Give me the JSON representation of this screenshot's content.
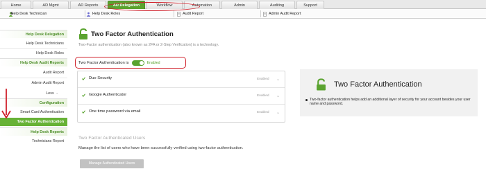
{
  "top_tabs": [
    {
      "label": "Home"
    },
    {
      "label": "AD Mgmt"
    },
    {
      "label": "AD Reports"
    },
    {
      "label": "AD Delegation",
      "active": true
    },
    {
      "label": "Workflow"
    },
    {
      "label": "Automation"
    },
    {
      "label": "Admin"
    },
    {
      "label": "Auditing"
    },
    {
      "label": "Support"
    }
  ],
  "sub_nav": {
    "help_desk_technician": "Help Desk Technician",
    "help_desk_technician_prefix": "S",
    "help_desk_roles": "Help Desk Roles",
    "audit_report": "Audit Report",
    "admin_audit_report": "Admin Audit Report"
  },
  "sidebar": {
    "section_delegation": "Help Desk Delegation",
    "help_desk_technicians": "Help Desk Technicians",
    "help_desk_roles": "Help Desk Roles",
    "section_audit": "Help Desk Audit Reports",
    "audit_report": "Audit Report",
    "admin_audit_report": "Admin Audit Report",
    "less": "Less",
    "less_marker": "-",
    "section_configuration": "Configuration",
    "smart_card_authentication": "Smart Card Authentication",
    "two_factor_authentication": "Two Factor Authentication",
    "section_reports": "Help Desk Reports",
    "technicians_report": "Technicians Report"
  },
  "main": {
    "title": "Two Factor Authentication",
    "subtitle": "Two-Factor authentication (also known as 2FA or 2-Step Verification) is a technology.",
    "tfa_label": "Two Factor Authentication is",
    "tfa_state": "Enabled",
    "methods": [
      {
        "name": "Duo Security",
        "status": "Enabled"
      },
      {
        "name": "Google Authenticator",
        "status": "Enabled"
      },
      {
        "name": "One time password via email",
        "status": "Enabled"
      }
    ],
    "users_title": "Two Factor Authenticated Users",
    "users_desc": "Manage the list of users who have been successfully verified using two-factor authentication.",
    "manage_button": "Manage Authenticated Users"
  },
  "info_panel": {
    "title": "Two Factor Authentication",
    "bullet": "Two-factor authentication helps add an additional layer of security for your account besides your user name and password."
  },
  "colors": {
    "accent_green": "#5aa32f",
    "annotation_red": "#d0202a"
  }
}
